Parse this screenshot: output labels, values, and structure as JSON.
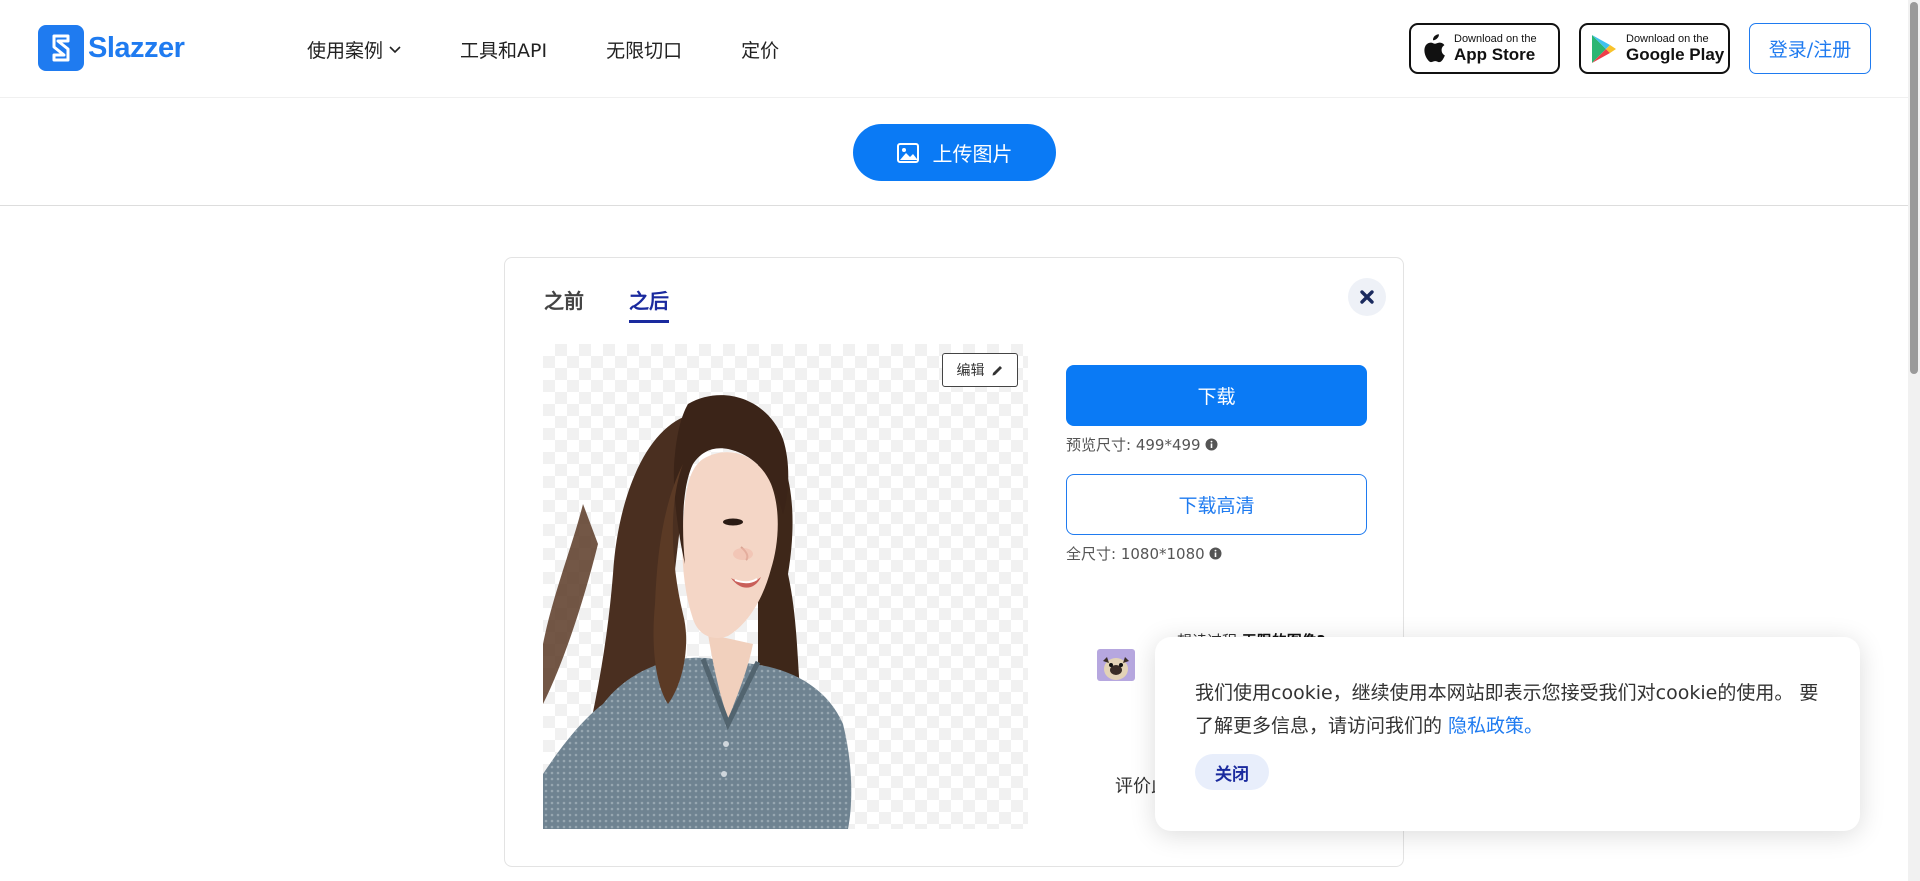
{
  "brand": {
    "name": "Slazzer",
    "color": "#1f7bf0"
  },
  "nav": {
    "items": [
      {
        "label": "使用案例",
        "has_dropdown": true
      },
      {
        "label": "工具和API"
      },
      {
        "label": "无限切口"
      },
      {
        "label": "定价"
      }
    ]
  },
  "stores": {
    "apple": {
      "small": "Download on the",
      "big": "App Store",
      "icon": "apple-icon"
    },
    "google": {
      "small": "Download on the",
      "big": "Google Play",
      "icon": "google-play-icon"
    }
  },
  "auth": {
    "login_label": "登录/注册"
  },
  "upload": {
    "label": "上传图片",
    "icon": "image-icon"
  },
  "result": {
    "tabs": [
      {
        "label": "之前",
        "active": false
      },
      {
        "label": "之后",
        "active": true
      }
    ],
    "close_icon": "close-icon",
    "edit_label": "编辑",
    "download_label": "下载",
    "preview_size": "预览尺寸: 499*499",
    "download_hd_label": "下载高清",
    "full_size": "全尺寸: 1080*1080",
    "promo_text": "想读过程",
    "promo_bold": "无限的图像?",
    "rate_text": "评价此"
  },
  "cookie": {
    "message": "我们使用cookie，继续使用本网站即表示您接受我们对cookie的使用。 要了解更多信息，请访问我们的",
    "link_label": "隐私政策。",
    "close_label": "关闭"
  },
  "colors": {
    "primary": "#0a7af5",
    "tab_active": "#1a2a9e"
  }
}
